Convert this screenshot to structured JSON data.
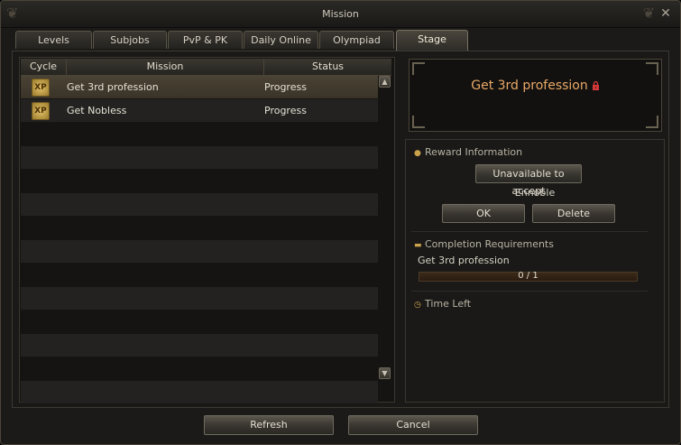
{
  "window": {
    "title": "Mission"
  },
  "tabs": [
    {
      "label": "Levels",
      "active": false
    },
    {
      "label": "Subjobs",
      "active": false
    },
    {
      "label": "PvP & PK",
      "active": false
    },
    {
      "label": "Daily Online",
      "active": false
    },
    {
      "label": "Olympiad",
      "active": false
    },
    {
      "label": "Stage",
      "active": true
    }
  ],
  "table": {
    "headers": {
      "cycle": "Cycle",
      "mission": "Mission",
      "status": "Status"
    },
    "rows": [
      {
        "cycle_icon": "XP",
        "mission": "Get 3rd profession",
        "status": "Progress",
        "selected": true
      },
      {
        "cycle_icon": "XP",
        "mission": "Get Nobless",
        "status": "Progress",
        "selected": false
      }
    ]
  },
  "detail": {
    "title": "Get 3rd profession",
    "title_color": "#e9a866",
    "lock_icon": "lock-icon"
  },
  "reward": {
    "heading": "Reward Information",
    "icon": "reward-bag-icon",
    "accept_button": "Unavailable to accept",
    "reward_text": "Ennoble",
    "ok_button": "OK",
    "delete_button": "Delete"
  },
  "completion": {
    "heading": "Completion Requirements",
    "icon": "scroll-icon",
    "requirement": "Get 3rd profession",
    "progress_text": "0 / 1",
    "progress_fraction": 0
  },
  "time": {
    "heading": "Time Left",
    "icon": "clock-icon"
  },
  "footer": {
    "refresh_button": "Refresh",
    "cancel_button": "Cancel"
  }
}
